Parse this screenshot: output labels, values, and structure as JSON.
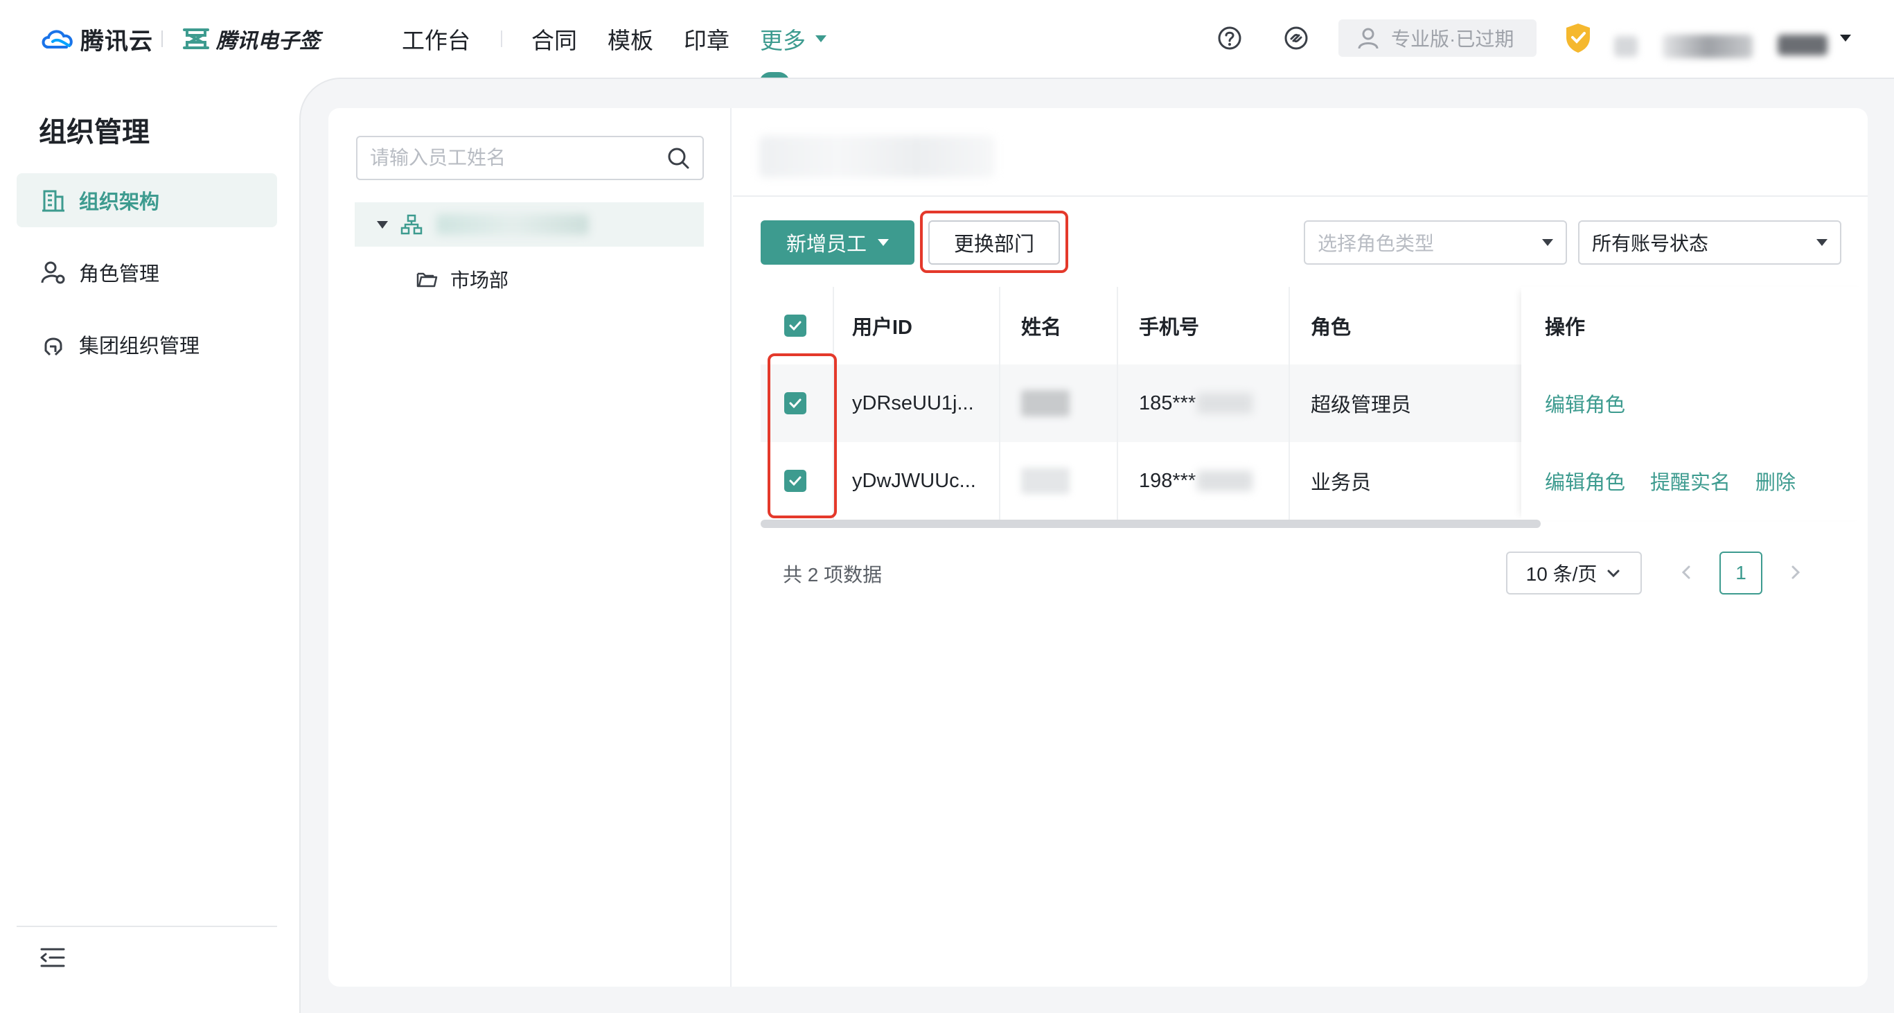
{
  "colors": {
    "accent": "#3d9b8f",
    "highlight": "#e4392b"
  },
  "brand": {
    "tencent_cloud": "腾讯云",
    "esign": "腾讯电子签"
  },
  "nav": {
    "items": [
      "工作台",
      "合同",
      "模板",
      "印章"
    ],
    "more": "更多"
  },
  "header": {
    "version_badge": "专业版·已过期"
  },
  "sidebar": {
    "title": "组织管理",
    "items": [
      {
        "label": "组织架构",
        "icon": "building-icon",
        "active": true
      },
      {
        "label": "角色管理",
        "icon": "user-gear-icon",
        "active": false
      },
      {
        "label": "集团组织管理",
        "icon": "group-org-icon",
        "active": false
      }
    ]
  },
  "tree": {
    "search_placeholder": "请输入员工姓名",
    "child": "市场部"
  },
  "toolbar": {
    "add_employee": "新增员工",
    "change_department": "更换部门",
    "role_type_placeholder": "选择角色类型",
    "account_status": "所有账号状态"
  },
  "table": {
    "columns": [
      "用户ID",
      "姓名",
      "手机号",
      "角色",
      "操作"
    ],
    "rows": [
      {
        "user_id": "yDRseUU1j...",
        "phone": "185***",
        "role": "超级管理员",
        "actions": [
          "编辑角色"
        ],
        "checked": true
      },
      {
        "user_id": "yDwJWUUc...",
        "phone": "198***",
        "role": "业务员",
        "actions": [
          "编辑角色",
          "提醒实名",
          "删除"
        ],
        "checked": true
      }
    ]
  },
  "pagination": {
    "total": "共 2 项数据",
    "page_size": "10 条/页",
    "current_page": "1"
  }
}
